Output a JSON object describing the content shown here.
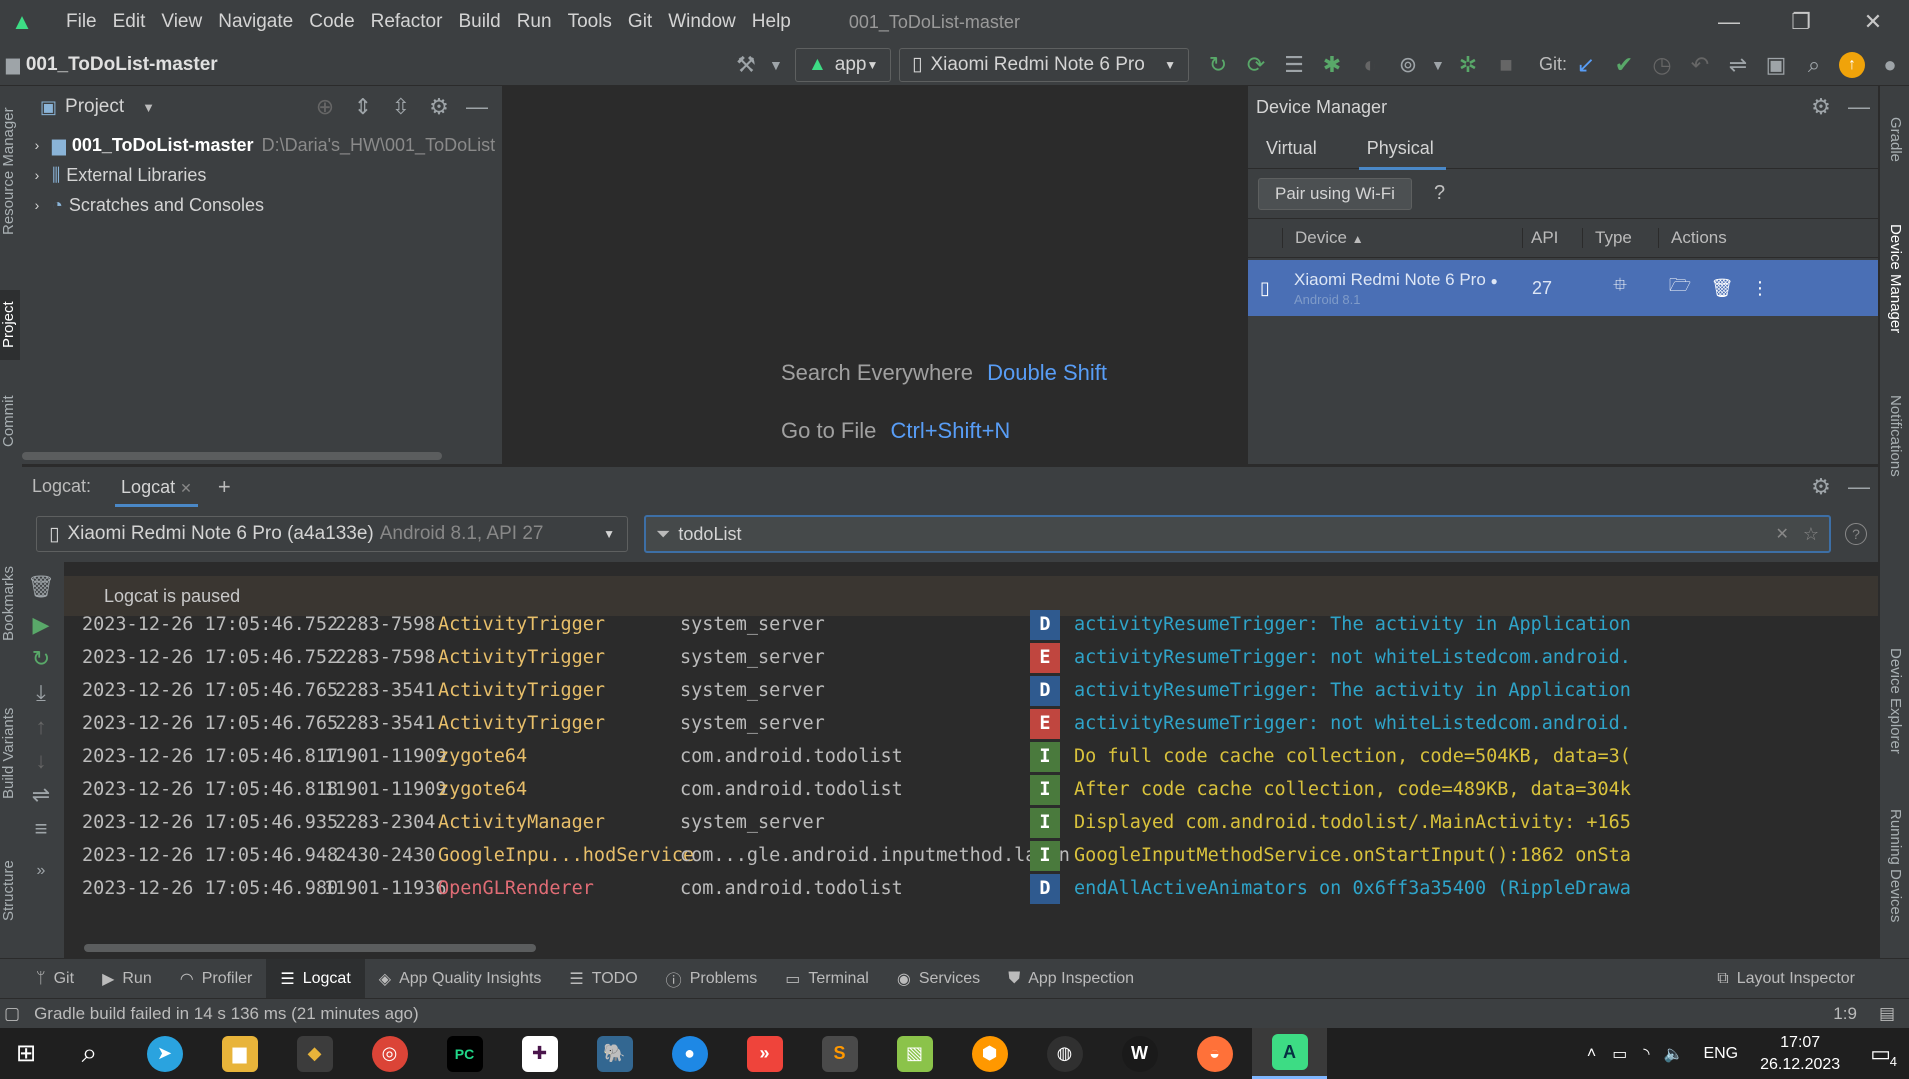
{
  "window": {
    "menu": [
      "File",
      "Edit",
      "View",
      "Navigate",
      "Code",
      "Refactor",
      "Build",
      "Run",
      "Tools",
      "Git",
      "Window",
      "Help"
    ],
    "title": "001_ToDoList-master",
    "controls": {
      "minimize": "—",
      "restore": "❐",
      "close": "✕"
    }
  },
  "toolbar": {
    "project_name": "001_ToDoList-master",
    "run_config": "app",
    "device": "Xiaomi Redmi Note 6 Pro",
    "git_label": "Git:"
  },
  "left_strip": {
    "resource_manager": "Resource Manager",
    "project": "Project",
    "commit": "Commit",
    "bookmarks": "Bookmarks",
    "build_variants": "Build Variants",
    "structure": "Structure"
  },
  "right_strip": {
    "gradle": "Gradle",
    "device_manager": "Device Manager",
    "notifications": "Notifications",
    "device_explorer": "Device Explorer",
    "running_devices": "Running Devices"
  },
  "project_panel": {
    "title": "Project",
    "items": [
      {
        "label": "001_ToDoList-master",
        "path": "D:\\Daria's_HW\\001_ToDoList"
      },
      {
        "label": "External Libraries"
      },
      {
        "label": "Scratches and Consoles"
      }
    ]
  },
  "editor": {
    "hint1_label": "Search Everywhere",
    "hint1_key": "Double Shift",
    "hint2_label": "Go to File",
    "hint2_key": "Ctrl+Shift+N"
  },
  "device_manager": {
    "title": "Device Manager",
    "tabs": [
      "Virtual",
      "Physical"
    ],
    "pair_button": "Pair using Wi-Fi",
    "help": "?",
    "columns": [
      "Device",
      "API",
      "Type",
      "Actions"
    ],
    "device": {
      "name": "Xiaomi Redmi Note 6 Pro",
      "os": "Android 8.1",
      "api": "27"
    }
  },
  "logcat": {
    "label": "Logcat:",
    "tab": "Logcat",
    "device_select": "Xiaomi Redmi Note 6 Pro (a4a133e)",
    "device_select_detail": "Android 8.1, API 27",
    "filter": "todoList",
    "paused": "Logcat is paused",
    "rows": [
      {
        "time": "2023-12-26 17:05:46.752",
        "pid": " 2283-7598",
        "tag": "ActivityTrigger",
        "pkg": "system_server",
        "level": "D",
        "msg": "activityResumeTrigger: The activity in Application"
      },
      {
        "time": "2023-12-26 17:05:46.752",
        "pid": " 2283-7598",
        "tag": "ActivityTrigger",
        "pkg": "system_server",
        "level": "E",
        "msg": "activityResumeTrigger: not whiteListedcom.android."
      },
      {
        "time": "2023-12-26 17:05:46.765",
        "pid": " 2283-3541",
        "tag": "ActivityTrigger",
        "pkg": "system_server",
        "level": "D",
        "msg": "activityResumeTrigger: The activity in Application"
      },
      {
        "time": "2023-12-26 17:05:46.765",
        "pid": " 2283-3541",
        "tag": "ActivityTrigger",
        "pkg": "system_server",
        "level": "E",
        "msg": "activityResumeTrigger: not whiteListedcom.android."
      },
      {
        "time": "2023-12-26 17:05:46.817",
        "pid": "11901-11909",
        "tag": "zygote64",
        "pkg": "com.android.todolist",
        "level": "I",
        "msg": "Do full code cache collection, code=504KB, data=3("
      },
      {
        "time": "2023-12-26 17:05:46.818",
        "pid": "11901-11909",
        "tag": "zygote64",
        "pkg": "com.android.todolist",
        "level": "I",
        "msg": "After code cache collection, code=489KB, data=304k"
      },
      {
        "time": "2023-12-26 17:05:46.935",
        "pid": " 2283-2304",
        "tag": "ActivityManager",
        "pkg": "system_server",
        "level": "I",
        "msg": "Displayed com.android.todolist/.MainActivity: +165"
      },
      {
        "time": "2023-12-26 17:05:46.948",
        "pid": " 2430-2430",
        "tag": "GoogleInpu...hodService",
        "pkg": "com...gle.android.inputmethod.latin",
        "level": "I",
        "msg": "GoogleInputMethodService.onStartInput():1862 onSta"
      },
      {
        "time": "2023-12-26 17:05:46.980",
        "pid": "11901-11936",
        "tag": "OpenGLRenderer",
        "pkg": "com.android.todolist",
        "level": "D",
        "msg": "endAllActiveAnimators on 0x6ff3a35400 (RippleDrawa"
      }
    ]
  },
  "bottom_tabs": [
    "Git",
    "Run",
    "Profiler",
    "Logcat",
    "App Quality Insights",
    "TODO",
    "Problems",
    "Terminal",
    "Services",
    "App Inspection"
  ],
  "layout_inspector": "Layout Inspector",
  "status": {
    "message": "Gradle build failed in 14 s 136 ms (21 minutes ago)",
    "position": "1:9"
  },
  "taskbar": {
    "lang": "ENG",
    "time": "17:07",
    "date": "26.12.2023",
    "notif_count": "4"
  },
  "colors": {
    "accent": "#589df6",
    "selected_row": "#4a6fb5",
    "level_D": "#2f5a8f",
    "level_E": "#c0463f",
    "level_I": "#4a7a3d",
    "tag": "#e8bf6a",
    "msg_D": "#2fa4c9",
    "msg_I": "#d9c23c"
  }
}
